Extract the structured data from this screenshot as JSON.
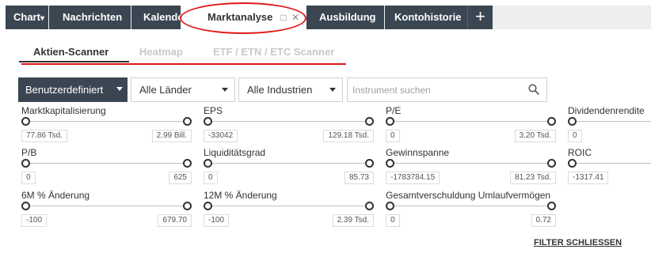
{
  "topbar": {
    "tabs": [
      {
        "label": "Chart",
        "has_dropdown": true
      },
      {
        "label": "Nachrichten"
      },
      {
        "label": "Kalender"
      },
      {
        "label": "Marktanalyse",
        "active": true
      },
      {
        "label": "Ausbildung"
      },
      {
        "label": "Kontohistorie"
      }
    ],
    "add_tab_symbol": "+",
    "dropdown_arrow": "▾"
  },
  "subtabs": [
    {
      "label": "Aktien-Scanner",
      "active": true
    },
    {
      "label": "Heatmap",
      "active": false
    },
    {
      "label": "ETF / ETN / ETC Scanner",
      "active": false
    }
  ],
  "toolbar": {
    "preset": "Benutzerdefiniert",
    "countries": "Alle Länder",
    "industries": "Alle Industrien",
    "search_placeholder": "Instrument suchen"
  },
  "filters": [
    {
      "label": "Marktkapitalisierung",
      "min": "77.86 Tsd.",
      "max": "2.99 Bill."
    },
    {
      "label": "EPS",
      "min": "-33042",
      "max": "129.18 Tsd."
    },
    {
      "label": "P/E",
      "min": "0",
      "max": "3.20 Tsd."
    },
    {
      "label": "Dividendenrendite",
      "min": "0",
      "max": ""
    },
    {
      "label": "P/B",
      "min": "0",
      "max": "625"
    },
    {
      "label": "Liquiditätsgrad",
      "min": "0",
      "max": "85.73"
    },
    {
      "label": "Gewinnspanne",
      "min": "-1783784.15",
      "max": "81.23 Tsd."
    },
    {
      "label": "ROIC",
      "min": "-1317.41",
      "max": ""
    },
    {
      "label": "6M % Änderung",
      "min": "-100",
      "max": "679.70"
    },
    {
      "label": "12M % Änderung",
      "min": "-100",
      "max": "2.39 Tsd."
    },
    {
      "label": "Gesamtverschuldung Umlaufvermögen",
      "min": "0",
      "max": "0.72"
    }
  ],
  "close_filter_label": "FILTER SCHLIESSEN",
  "colors": {
    "tab_bg": "#3a4651",
    "annotation_red": "#e01818",
    "text": "#333333",
    "inactive_subtab": "#c8c8c8"
  }
}
